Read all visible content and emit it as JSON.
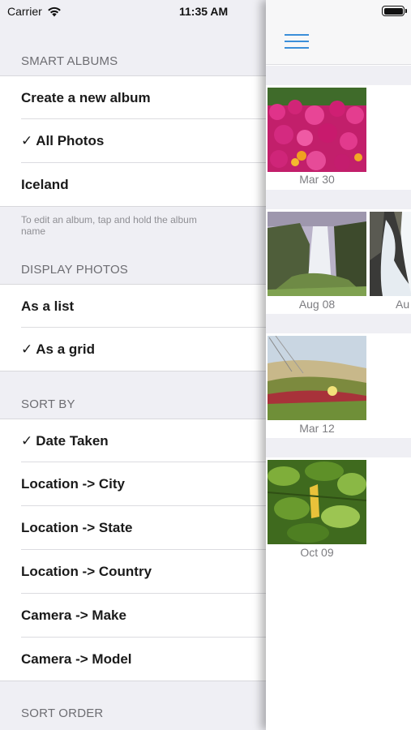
{
  "status_bar": {
    "carrier": "Carrier",
    "time": "11:35 AM"
  },
  "menu": {
    "smart_albums": {
      "header": "SMART ALBUMS",
      "items": [
        {
          "label": "Create a new album",
          "checked": false
        },
        {
          "label": "All Photos",
          "checked": true
        },
        {
          "label": "Iceland",
          "checked": false
        }
      ],
      "footer": "To edit an album, tap and hold the album name"
    },
    "display_photos": {
      "header": "DISPLAY PHOTOS",
      "items": [
        {
          "label": "As a list",
          "checked": false
        },
        {
          "label": "As a grid",
          "checked": true
        }
      ]
    },
    "sort_by": {
      "header": "SORT BY",
      "items": [
        {
          "label": "Date Taken",
          "checked": true
        },
        {
          "label": "Location -> City",
          "checked": false
        },
        {
          "label": "Location -> State",
          "checked": false
        },
        {
          "label": "Location -> Country",
          "checked": false
        },
        {
          "label": "Camera -> Make",
          "checked": false
        },
        {
          "label": "Camera -> Model",
          "checked": false
        }
      ]
    },
    "sort_order": {
      "header": "SORT ORDER"
    },
    "checkmark": "✓"
  },
  "content": {
    "menu_icon": "hamburger-menu-icon",
    "accent_color": "#3b8fd9",
    "photos": [
      {
        "date": "Mar 30",
        "subject": "magenta-flowers"
      },
      {
        "date": "Aug 08",
        "subject": "waterfall"
      },
      {
        "date": "Au",
        "subject": "waterfall-closeup"
      },
      {
        "date": "Mar 12",
        "subject": "grass-dune"
      },
      {
        "date": "Oct 09",
        "subject": "green-leaves"
      }
    ]
  }
}
